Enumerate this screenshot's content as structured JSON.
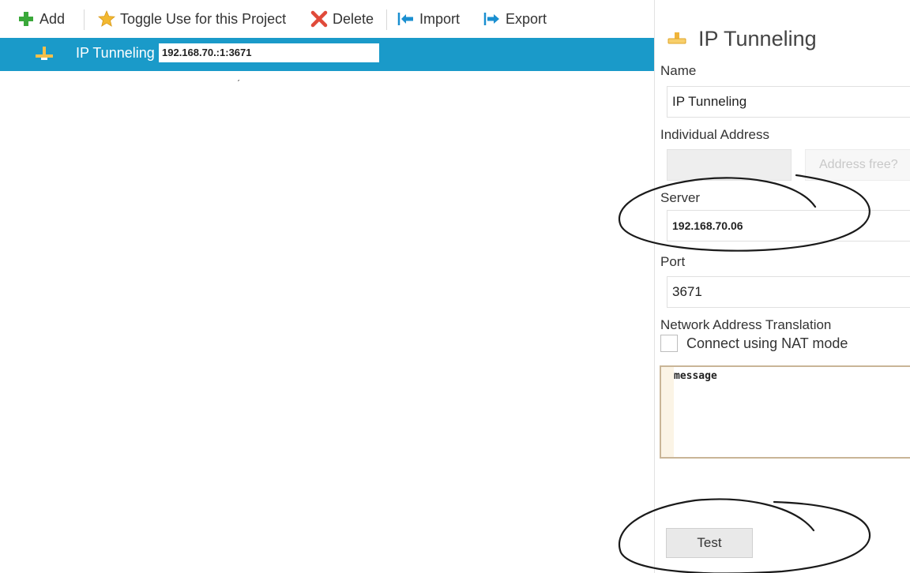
{
  "toolbar": {
    "add_label": "Add",
    "toggle_label": "Toggle Use for this Project",
    "delete_label": "Delete",
    "import_label": "Import",
    "export_label": "Export"
  },
  "tree": {
    "selected_item": {
      "label": "IP Tunneling",
      "address_value": "192.168.70.:1:3671"
    }
  },
  "panel": {
    "title": "IP Tunneling",
    "name_label": "Name",
    "name_value": "IP Tunneling",
    "individual_address_label": "Individual Address",
    "individual_address_value": "",
    "address_free_button": "Address free?",
    "server_label": "Server",
    "server_value": "192.168.70.06",
    "port_label": "Port",
    "port_value": "3671",
    "nat_label": "Network Address Translation",
    "nat_checkbox_label": "Connect using NAT mode",
    "nat_checked": false,
    "message_text": "message",
    "test_button": "Test"
  },
  "colors": {
    "selection": "#1a9ac9",
    "add_icon": "#3aa83a",
    "delete_icon": "#e04a3a",
    "arrow_icon": "#1a8fd0",
    "star_icon": "#f2b830"
  },
  "icons": [
    "add-icon",
    "star-icon",
    "delete-icon",
    "import-icon",
    "export-icon",
    "network-connection-icon"
  ]
}
